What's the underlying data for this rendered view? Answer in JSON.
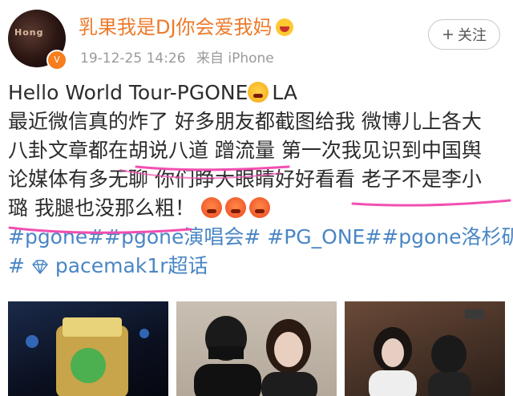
{
  "user": {
    "name": "乳果我是DJ你会爱我妈",
    "name_emoji": "angry-face-icon",
    "avatar_text": "Hong",
    "badge_icon": "vip-badge-icon"
  },
  "meta": {
    "timestamp": "19-12-25 14:26",
    "source": "来自 iPhone"
  },
  "follow_button": {
    "label": "关注",
    "icon": "plus-icon"
  },
  "post": {
    "line1_a": "Hello World Tour-PGONE",
    "line1_b": "LA",
    "line2": "最近微信真的炸了 好多朋友都截图给我 微博儿上各大",
    "line3": "八卦文章都在胡说八道 蹭流量 第一次我见识到中国舆",
    "line4": "论媒体有多无聊 你们睁大眼睛好好看看 老子不是李小",
    "line5": "璐 我腿也没那么粗！",
    "tags_line1": "#pgone##pgone演唱会# #PG_ONE##pgone洛杉矶",
    "tags_line2_prefix": "#",
    "tags_line2_rest": "pacemak1r超话"
  },
  "colors": {
    "username": "#ec7a2a",
    "tag": "#4a86c4",
    "highlight": "#f24fb0",
    "meta": "#9a9a9a"
  },
  "photos": [
    {
      "name": "photo-1",
      "desc_icon": "stage-photo"
    },
    {
      "name": "photo-2",
      "desc_icon": "selfie-photo"
    },
    {
      "name": "photo-3",
      "desc_icon": "concert-photo"
    }
  ]
}
